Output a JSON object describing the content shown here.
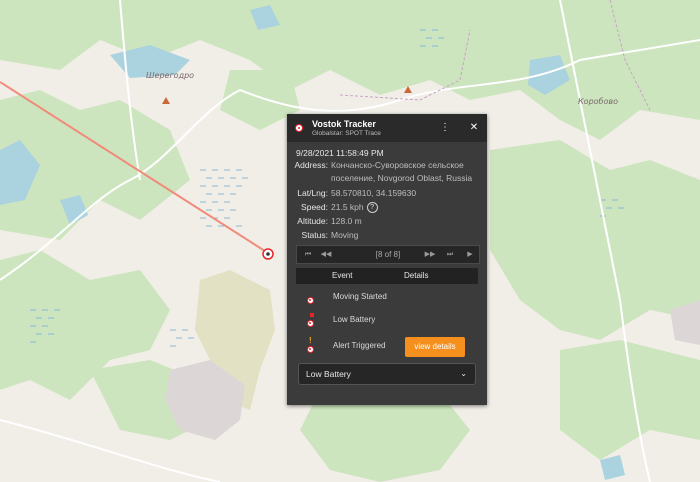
{
  "map": {
    "place_labels": [
      "Шерегодро",
      "Коробово"
    ],
    "track_color": "#f28a7a"
  },
  "panel": {
    "title": "Vostok Tracker",
    "subtitle": "Globalstar: SPOT Trace",
    "more_icon": "⋮",
    "close_icon": "✕",
    "timestamp": "9/28/2021 11:58:49 PM",
    "fields": {
      "address_label": "Address:",
      "address_line1": "Кончанско-Суворовское сельское",
      "address_line2": "поселение, Novgorod Oblast, Russia",
      "latlng_label": "Lat/Lng:",
      "latlng_value": "58.570810, 34.159630",
      "speed_label": "Speed:",
      "speed_value": "21.5 kph",
      "speed_help": "?",
      "altitude_label": "Altitude:",
      "altitude_value": "128.0 m",
      "status_label": "Status:",
      "status_value": "Moving"
    },
    "nav": {
      "first_icon": "⏮",
      "prev_icon": "◀◀",
      "counter": "[8 of 8]",
      "next_icon": "▶▶",
      "last_icon": "⏭",
      "play_icon": "▶"
    },
    "table": {
      "col_event": "Event",
      "col_details": "Details",
      "rows": [
        {
          "event": "Moving Started"
        },
        {
          "event": "Low Battery"
        },
        {
          "event": "Alert Triggered",
          "action": "view details"
        }
      ]
    },
    "select_value": "Low Battery",
    "select_chevron": "⌄",
    "accent_color": "#f5901e",
    "marker_color": "#e8242e"
  }
}
